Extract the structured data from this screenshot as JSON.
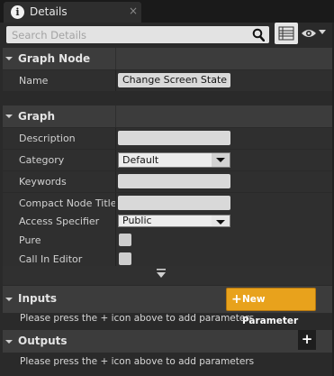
{
  "tab": {
    "icon": "info-icon",
    "icon_glyph": "i",
    "label": "Details",
    "close": "×"
  },
  "search": {
    "placeholder": "Search Details",
    "value": ""
  },
  "toolbar": {
    "view_options_icon": "list-view-icon",
    "visibility_icon": "eye-icon"
  },
  "sections": {
    "graph_node": {
      "title": "Graph Node",
      "rows": [
        {
          "label": "Name",
          "value": "Change Screen State"
        }
      ]
    },
    "graph": {
      "title": "Graph",
      "rows": {
        "description": {
          "label": "Description",
          "value": ""
        },
        "category": {
          "label": "Category",
          "value": "Default"
        },
        "keywords": {
          "label": "Keywords",
          "value": ""
        },
        "compact_node_title": {
          "label": "Compact Node Title",
          "value": ""
        },
        "access_specifier": {
          "label": "Access Specifier",
          "value": "Public"
        },
        "pure": {
          "label": "Pure",
          "checked": false
        },
        "call_in_editor": {
          "label": "Call In Editor",
          "checked": false
        }
      },
      "advanced_icon": "expand-advanced-icon"
    },
    "inputs": {
      "title": "Inputs",
      "new_parameter_label": "New Parameter",
      "message": "Please press the + icon above to add parameters"
    },
    "outputs": {
      "title": "Outputs",
      "add_label": "+",
      "message": "Please press the + icon above to add parameters"
    }
  },
  "colors": {
    "accent": "#e8a21c",
    "header_bg": "#3c3c3c",
    "row_bg": "#2f2f2f"
  }
}
